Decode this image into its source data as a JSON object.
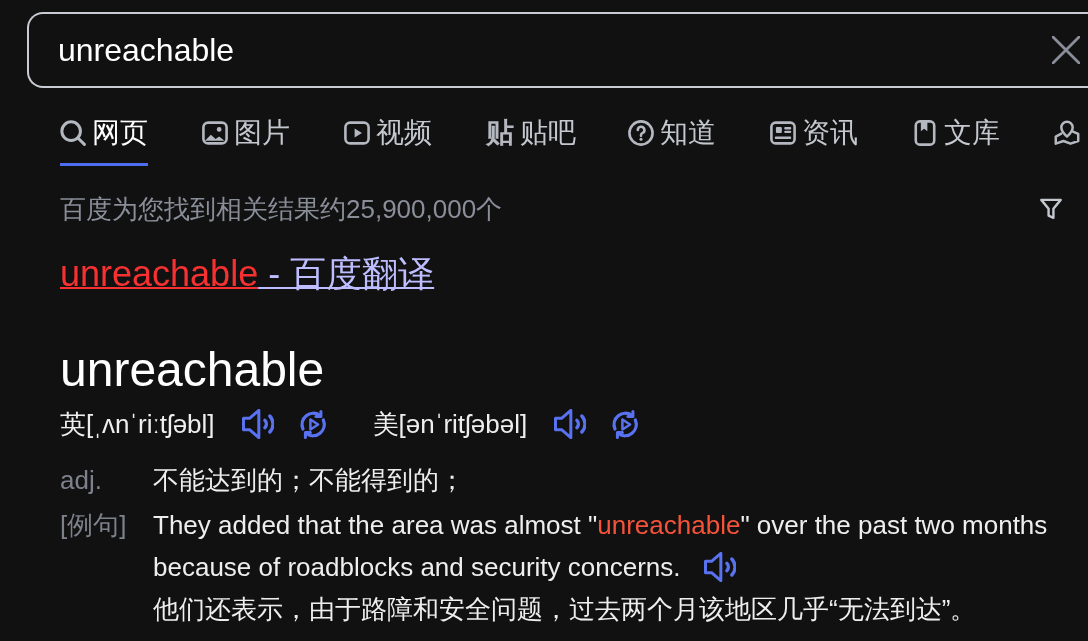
{
  "search": {
    "value": "unreachable"
  },
  "tabs": [
    {
      "label": "网页",
      "selected": true
    },
    {
      "label": "图片",
      "selected": false
    },
    {
      "label": "视频",
      "selected": false
    },
    {
      "glyph": "贴",
      "label": "贴吧",
      "selected": false
    },
    {
      "label": "知道",
      "selected": false
    },
    {
      "label": "资讯",
      "selected": false
    },
    {
      "label": "文库",
      "selected": false
    },
    {
      "selected": false
    }
  ],
  "result_count": "百度为您找到相关结果约25,900,000个",
  "result_title": {
    "keyword": "unreachable",
    "suffix": " - 百度翻译"
  },
  "dictionary": {
    "headword": "unreachable",
    "pronunciations": [
      {
        "phonetic": "英[ˌʌnˈriːtʃəbl]"
      },
      {
        "phonetic": "美[ənˈritʃəbəl]"
      }
    ],
    "definitions": [
      {
        "part_of_speech": "adj.",
        "meaning": "不能达到的；不能得到的；"
      }
    ],
    "example": {
      "label": "[例句]",
      "sentence_lines": [
        {
          "start": "They added that the area was almost \"",
          "keyword": "unreachable",
          "end": "\" over the past two months"
        },
        {
          "start": "because of roadblocks and security concerns."
        }
      ],
      "translation": "他们还表示，由于路障和安全问题，过去两个月该地区几乎“无法到达”。"
    }
  }
}
